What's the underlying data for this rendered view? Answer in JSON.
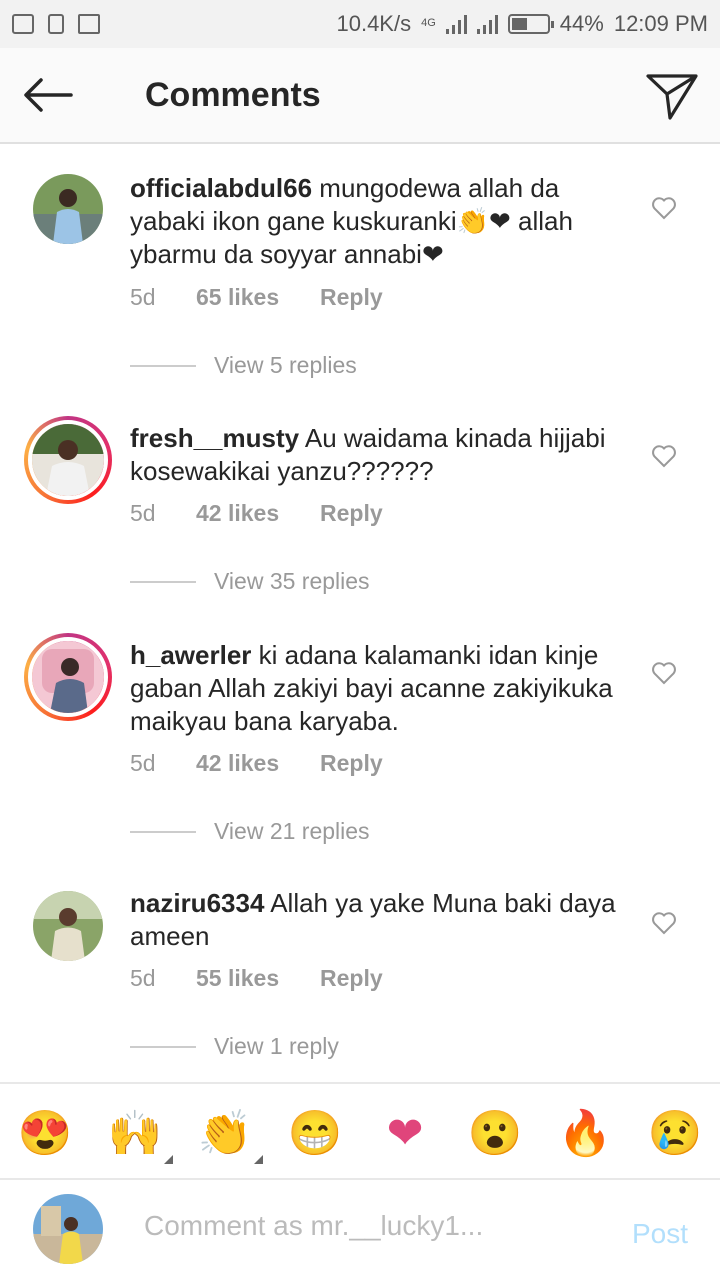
{
  "status_bar": {
    "network_speed": "10.4K/s",
    "network_type": "4G",
    "battery": "44%",
    "battery_level": 0.44,
    "time": "12:09 PM"
  },
  "header": {
    "title": "Comments",
    "back_icon": "arrow-left-icon",
    "send_icon": "paper-plane-icon"
  },
  "comments": [
    {
      "username": "officialabdul66",
      "text": "mungodewa allah da yabaki ikon gane kuskuranki👏❤ allah ybarmu da soyyar annabi❤",
      "time": "5d",
      "likes": "65 likes",
      "reply_label": "Reply",
      "view_replies": "View 5 replies",
      "avatar_story_ring": false
    },
    {
      "username": "fresh__musty",
      "text": "Au waidama kinada hijjabi kosewakikai yanzu??????",
      "time": "5d",
      "likes": "42 likes",
      "reply_label": "Reply",
      "view_replies": "View 35 replies",
      "avatar_story_ring": true
    },
    {
      "username": "h_awerler",
      "text": "ki adana kalamanki idan kinje gaban Allah zakiyi bayi acanne zakiyikuka maikyau bana karyaba.",
      "time": "5d",
      "likes": "42 likes",
      "reply_label": "Reply",
      "view_replies": "View 21 replies",
      "avatar_story_ring": true
    },
    {
      "username": "naziru6334",
      "text": "Allah ya yake Muna baki daya ameen",
      "time": "5d",
      "likes": "55 likes",
      "reply_label": "Reply",
      "view_replies": "View 1 reply",
      "avatar_story_ring": false
    }
  ],
  "emoji_bar": [
    "😍",
    "🙌",
    "👏",
    "😁",
    "❤",
    "😮",
    "🔥",
    "😢"
  ],
  "composer": {
    "placeholder": "Comment as mr.__lucky1...",
    "post_label": "Post"
  },
  "colors": {
    "heart_pink": "#e0457b",
    "post_disabled": "#b2dffc",
    "muted_text": "#999999"
  }
}
